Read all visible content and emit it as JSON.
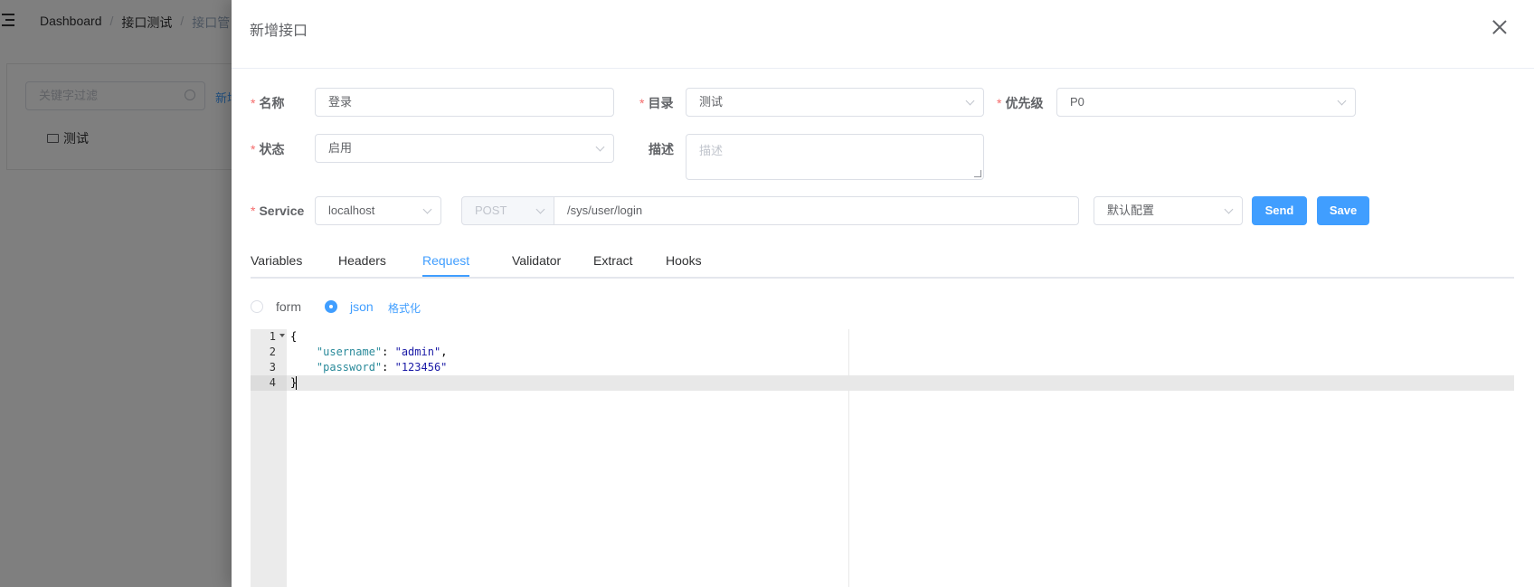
{
  "background": {
    "breadcrumb": [
      "Dashboard",
      "接口测试",
      "接口管"
    ],
    "search_placeholder": "关键字过滤",
    "new_link": "新增",
    "tree_item": "测试"
  },
  "drawer": {
    "title": "新增接口",
    "form": {
      "name_label": "名称",
      "name_value": "登录",
      "dir_label": "目录",
      "dir_value": "测试",
      "priority_label": "优先级",
      "priority_value": "P0",
      "status_label": "状态",
      "status_value": "启用",
      "desc_label": "描述",
      "desc_placeholder": "描述",
      "service_label": "Service",
      "service_value": "localhost",
      "method_value": "POST",
      "url_value": "/sys/user/login",
      "config_value": "默认配置",
      "send_label": "Send",
      "save_label": "Save"
    },
    "tabs": [
      "Variables",
      "Headers",
      "Request",
      "Validator",
      "Extract",
      "Hooks"
    ],
    "active_tab": "Request",
    "body_types": [
      "form",
      "json"
    ],
    "selected_body_type": "json",
    "format_label": "格式化",
    "editor": {
      "line_numbers": [
        "1",
        "2",
        "3",
        "4"
      ],
      "line1": "{",
      "line2_key": "\"username\"",
      "line2_sep": ": ",
      "line2_val": "\"admin\"",
      "line2_end": ",",
      "line3_key": "\"password\"",
      "line3_sep": ": ",
      "line3_val": "\"123456\"",
      "line4": "}"
    }
  },
  "colors": {
    "primary": "#409eff",
    "required": "#f56c6c",
    "overlay": "rgba(0,0,0,0.5)"
  }
}
